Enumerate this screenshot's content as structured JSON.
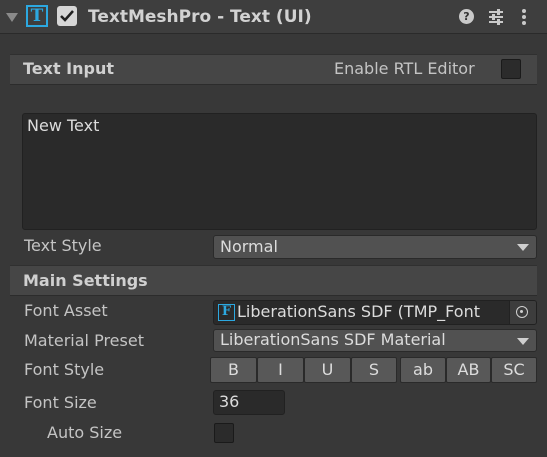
{
  "header": {
    "title": "TextMeshPro - Text (UI)",
    "enabled": true,
    "component_icon": "textmeshpro-t-icon"
  },
  "text_input": {
    "section_title": "Text Input",
    "rtl_label": "Enable RTL Editor",
    "rtl_checked": false,
    "text_value": "New Text",
    "text_style_label": "Text Style",
    "text_style_value": "Normal"
  },
  "main_settings": {
    "section_title": "Main Settings",
    "font_asset_label": "Font Asset",
    "font_asset_value": "LiberationSans SDF (TMP_Font",
    "material_preset_label": "Material Preset",
    "material_preset_value": "LiberationSans SDF Material",
    "font_style_label": "Font Style",
    "font_style_buttons": [
      "B",
      "I",
      "U",
      "S",
      "ab",
      "AB",
      "SC"
    ],
    "font_size_label": "Font Size",
    "font_size_value": "36",
    "auto_size_label": "Auto Size",
    "auto_size_checked": false
  },
  "colors": {
    "background": "#383838",
    "accent": "#2ca8e0"
  }
}
